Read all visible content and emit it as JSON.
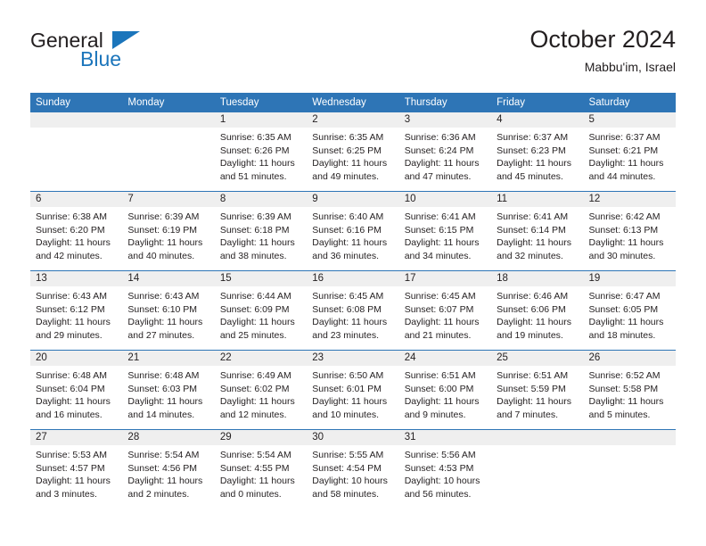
{
  "brand": {
    "line1": "General",
    "line2": "Blue",
    "triangle_icon": "triangle-icon",
    "colors": {
      "text": "#231f20",
      "blue": "#1b75bb"
    }
  },
  "header": {
    "title": "October 2024",
    "subtitle": "Mabbu'im, Israel"
  },
  "theme": {
    "header_blue": "#2e75b6",
    "daynum_band": "#efefef",
    "cell_bg": "#ffffff",
    "text": "#231f20"
  },
  "calendar": {
    "weekday_headers": [
      "Sunday",
      "Monday",
      "Tuesday",
      "Wednesday",
      "Thursday",
      "Friday",
      "Saturday"
    ],
    "labels": {
      "sunrise": "Sunrise:",
      "sunset": "Sunset:",
      "daylight": "Daylight:"
    },
    "weeks": [
      [
        {
          "day": "",
          "empty": true
        },
        {
          "day": "",
          "empty": true
        },
        {
          "day": "1",
          "sunrise": "Sunrise: 6:35 AM",
          "sunset": "Sunset: 6:26 PM",
          "daylight1": "Daylight: 11 hours",
          "daylight2": "and 51 minutes."
        },
        {
          "day": "2",
          "sunrise": "Sunrise: 6:35 AM",
          "sunset": "Sunset: 6:25 PM",
          "daylight1": "Daylight: 11 hours",
          "daylight2": "and 49 minutes."
        },
        {
          "day": "3",
          "sunrise": "Sunrise: 6:36 AM",
          "sunset": "Sunset: 6:24 PM",
          "daylight1": "Daylight: 11 hours",
          "daylight2": "and 47 minutes."
        },
        {
          "day": "4",
          "sunrise": "Sunrise: 6:37 AM",
          "sunset": "Sunset: 6:23 PM",
          "daylight1": "Daylight: 11 hours",
          "daylight2": "and 45 minutes."
        },
        {
          "day": "5",
          "sunrise": "Sunrise: 6:37 AM",
          "sunset": "Sunset: 6:21 PM",
          "daylight1": "Daylight: 11 hours",
          "daylight2": "and 44 minutes."
        }
      ],
      [
        {
          "day": "6",
          "sunrise": "Sunrise: 6:38 AM",
          "sunset": "Sunset: 6:20 PM",
          "daylight1": "Daylight: 11 hours",
          "daylight2": "and 42 minutes."
        },
        {
          "day": "7",
          "sunrise": "Sunrise: 6:39 AM",
          "sunset": "Sunset: 6:19 PM",
          "daylight1": "Daylight: 11 hours",
          "daylight2": "and 40 minutes."
        },
        {
          "day": "8",
          "sunrise": "Sunrise: 6:39 AM",
          "sunset": "Sunset: 6:18 PM",
          "daylight1": "Daylight: 11 hours",
          "daylight2": "and 38 minutes."
        },
        {
          "day": "9",
          "sunrise": "Sunrise: 6:40 AM",
          "sunset": "Sunset: 6:16 PM",
          "daylight1": "Daylight: 11 hours",
          "daylight2": "and 36 minutes."
        },
        {
          "day": "10",
          "sunrise": "Sunrise: 6:41 AM",
          "sunset": "Sunset: 6:15 PM",
          "daylight1": "Daylight: 11 hours",
          "daylight2": "and 34 minutes."
        },
        {
          "day": "11",
          "sunrise": "Sunrise: 6:41 AM",
          "sunset": "Sunset: 6:14 PM",
          "daylight1": "Daylight: 11 hours",
          "daylight2": "and 32 minutes."
        },
        {
          "day": "12",
          "sunrise": "Sunrise: 6:42 AM",
          "sunset": "Sunset: 6:13 PM",
          "daylight1": "Daylight: 11 hours",
          "daylight2": "and 30 minutes."
        }
      ],
      [
        {
          "day": "13",
          "sunrise": "Sunrise: 6:43 AM",
          "sunset": "Sunset: 6:12 PM",
          "daylight1": "Daylight: 11 hours",
          "daylight2": "and 29 minutes."
        },
        {
          "day": "14",
          "sunrise": "Sunrise: 6:43 AM",
          "sunset": "Sunset: 6:10 PM",
          "daylight1": "Daylight: 11 hours",
          "daylight2": "and 27 minutes."
        },
        {
          "day": "15",
          "sunrise": "Sunrise: 6:44 AM",
          "sunset": "Sunset: 6:09 PM",
          "daylight1": "Daylight: 11 hours",
          "daylight2": "and 25 minutes."
        },
        {
          "day": "16",
          "sunrise": "Sunrise: 6:45 AM",
          "sunset": "Sunset: 6:08 PM",
          "daylight1": "Daylight: 11 hours",
          "daylight2": "and 23 minutes."
        },
        {
          "day": "17",
          "sunrise": "Sunrise: 6:45 AM",
          "sunset": "Sunset: 6:07 PM",
          "daylight1": "Daylight: 11 hours",
          "daylight2": "and 21 minutes."
        },
        {
          "day": "18",
          "sunrise": "Sunrise: 6:46 AM",
          "sunset": "Sunset: 6:06 PM",
          "daylight1": "Daylight: 11 hours",
          "daylight2": "and 19 minutes."
        },
        {
          "day": "19",
          "sunrise": "Sunrise: 6:47 AM",
          "sunset": "Sunset: 6:05 PM",
          "daylight1": "Daylight: 11 hours",
          "daylight2": "and 18 minutes."
        }
      ],
      [
        {
          "day": "20",
          "sunrise": "Sunrise: 6:48 AM",
          "sunset": "Sunset: 6:04 PM",
          "daylight1": "Daylight: 11 hours",
          "daylight2": "and 16 minutes."
        },
        {
          "day": "21",
          "sunrise": "Sunrise: 6:48 AM",
          "sunset": "Sunset: 6:03 PM",
          "daylight1": "Daylight: 11 hours",
          "daylight2": "and 14 minutes."
        },
        {
          "day": "22",
          "sunrise": "Sunrise: 6:49 AM",
          "sunset": "Sunset: 6:02 PM",
          "daylight1": "Daylight: 11 hours",
          "daylight2": "and 12 minutes."
        },
        {
          "day": "23",
          "sunrise": "Sunrise: 6:50 AM",
          "sunset": "Sunset: 6:01 PM",
          "daylight1": "Daylight: 11 hours",
          "daylight2": "and 10 minutes."
        },
        {
          "day": "24",
          "sunrise": "Sunrise: 6:51 AM",
          "sunset": "Sunset: 6:00 PM",
          "daylight1": "Daylight: 11 hours",
          "daylight2": "and 9 minutes."
        },
        {
          "day": "25",
          "sunrise": "Sunrise: 6:51 AM",
          "sunset": "Sunset: 5:59 PM",
          "daylight1": "Daylight: 11 hours",
          "daylight2": "and 7 minutes."
        },
        {
          "day": "26",
          "sunrise": "Sunrise: 6:52 AM",
          "sunset": "Sunset: 5:58 PM",
          "daylight1": "Daylight: 11 hours",
          "daylight2": "and 5 minutes."
        }
      ],
      [
        {
          "day": "27",
          "sunrise": "Sunrise: 5:53 AM",
          "sunset": "Sunset: 4:57 PM",
          "daylight1": "Daylight: 11 hours",
          "daylight2": "and 3 minutes."
        },
        {
          "day": "28",
          "sunrise": "Sunrise: 5:54 AM",
          "sunset": "Sunset: 4:56 PM",
          "daylight1": "Daylight: 11 hours",
          "daylight2": "and 2 minutes."
        },
        {
          "day": "29",
          "sunrise": "Sunrise: 5:54 AM",
          "sunset": "Sunset: 4:55 PM",
          "daylight1": "Daylight: 11 hours",
          "daylight2": "and 0 minutes."
        },
        {
          "day": "30",
          "sunrise": "Sunrise: 5:55 AM",
          "sunset": "Sunset: 4:54 PM",
          "daylight1": "Daylight: 10 hours",
          "daylight2": "and 58 minutes."
        },
        {
          "day": "31",
          "sunrise": "Sunrise: 5:56 AM",
          "sunset": "Sunset: 4:53 PM",
          "daylight1": "Daylight: 10 hours",
          "daylight2": "and 56 minutes."
        },
        {
          "day": "",
          "empty": true
        },
        {
          "day": "",
          "empty": true
        }
      ]
    ]
  }
}
